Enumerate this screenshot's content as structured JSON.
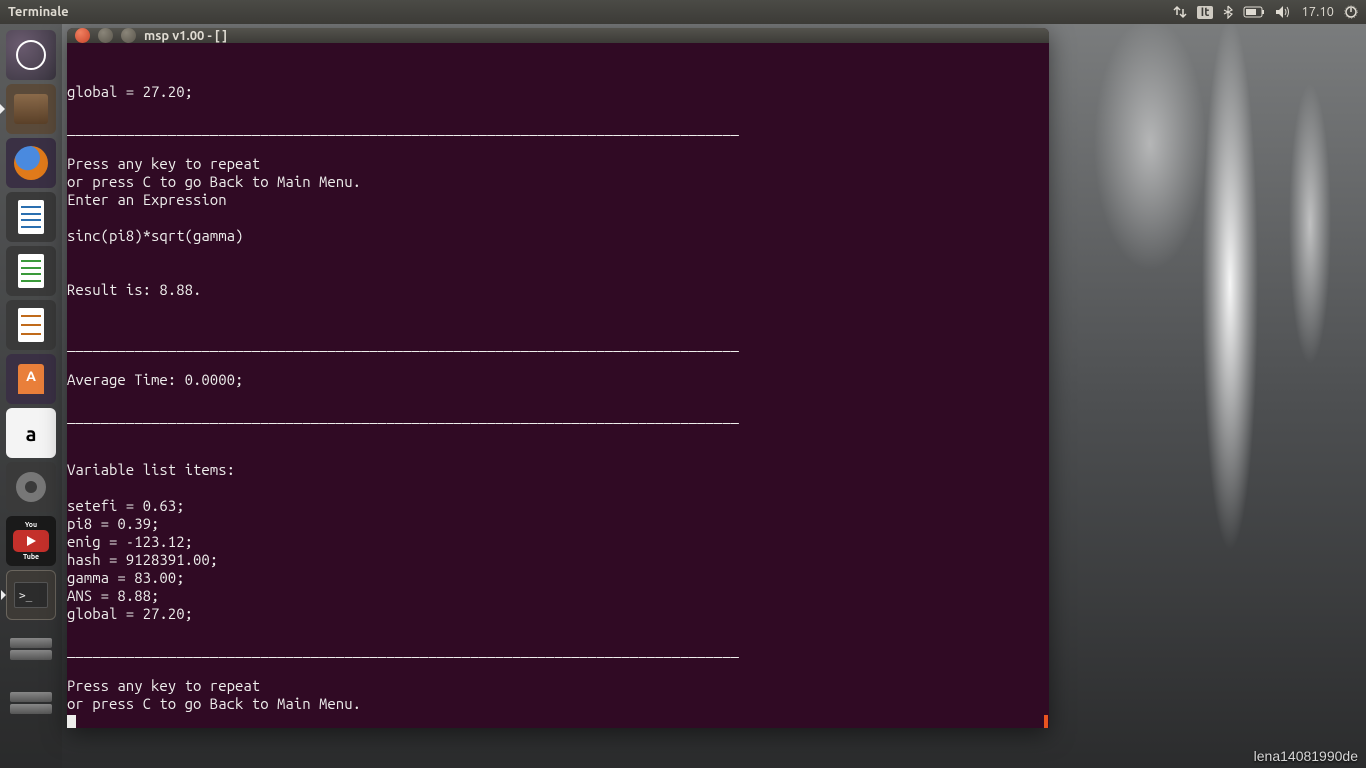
{
  "menubar": {
    "app_name": "Terminale",
    "keyboard_layout": "It",
    "clock": "17.10"
  },
  "launcher": {
    "items": [
      {
        "name": "dash",
        "label": "Dash"
      },
      {
        "name": "files",
        "label": "Files"
      },
      {
        "name": "firefox",
        "label": "Firefox"
      },
      {
        "name": "writer",
        "label": "LibreOffice Writer"
      },
      {
        "name": "calc",
        "label": "LibreOffice Calc"
      },
      {
        "name": "impress",
        "label": "LibreOffice Impress"
      },
      {
        "name": "software",
        "label": "Ubuntu Software"
      },
      {
        "name": "amazon",
        "label": "Amazon"
      },
      {
        "name": "settings",
        "label": "System Settings"
      },
      {
        "name": "youtube",
        "label": "YouTube"
      },
      {
        "name": "terminal",
        "label": "Terminal"
      },
      {
        "name": "workspaces",
        "label": "Workspace Switcher"
      },
      {
        "name": "trash",
        "label": "Trash"
      }
    ],
    "youtube_top": "You",
    "youtube_bottom": "Tube",
    "terminal_prompt": ">_"
  },
  "window": {
    "title": "msp v1.00 - [ ]"
  },
  "terminal": {
    "lines": [
      "global = 27.20;",
      "",
      "________________________________________________________________________________",
      "",
      "Press any key to repeat",
      "or press C to go Back to Main Menu.",
      "Enter an Expression",
      "",
      "sinc(pi8)*sqrt(gamma)",
      "",
      "",
      "Result is: 8.88.",
      "",
      "",
      "________________________________________________________________________________",
      "",
      "Average Time: 0.0000;",
      "",
      "________________________________________________________________________________",
      "",
      "",
      "Variable list items:",
      "",
      "setefi = 0.63;",
      "pi8 = 0.39;",
      "enig = -123.12;",
      "hash = 9128391.00;",
      "gamma = 83.00;",
      "ANS = 8.88;",
      "global = 27.20;",
      "",
      "________________________________________________________________________________",
      "",
      "Press any key to repeat",
      "or press C to go Back to Main Menu."
    ]
  },
  "watermark": "lena14081990de"
}
